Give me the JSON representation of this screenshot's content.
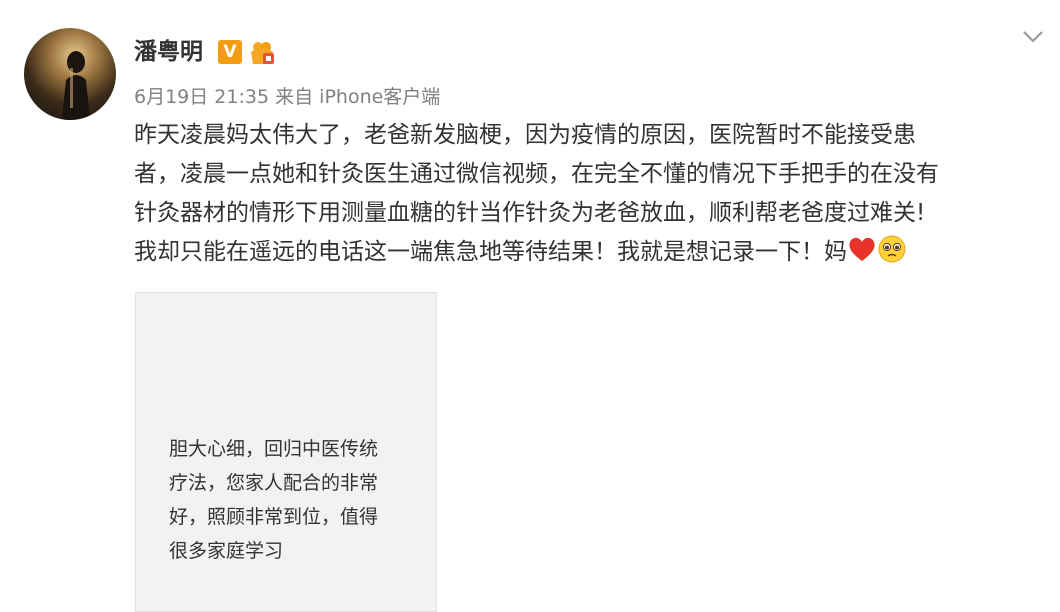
{
  "post": {
    "author": "潘粤明",
    "verified_badge": "V",
    "timestamp": "6月19日 21:35",
    "source_prefix": "来自",
    "source_device": "iPhone客户端",
    "text_lines": [
      "昨天凌晨妈太伟大了，老爸新发脑梗，因为疫情的原因，医院暂时不能接受患",
      "者，凌晨一点她和针灸医生通过微信视频，在完全不懂的情况下手把手的在没有",
      "针灸器材的情形下用测量血糖的针当作针灸为老爸放血，顺利帮老爸度过难关!",
      "我却只能在遥远的电话这一端焦急地等待结果！我就是想记录一下！妈"
    ],
    "emojis": [
      "heart-icon",
      "pleading-face-icon"
    ]
  },
  "card": {
    "lines": [
      "胆大心细，回归中医传统",
      "疗法，您家人配合的非常",
      "好，照顾非常到位，值得",
      "很多家庭学习"
    ]
  },
  "colors": {
    "text": "#333333",
    "meta": "#808080",
    "badge": "#f39c12",
    "card_bg": "#f2f2f2"
  }
}
